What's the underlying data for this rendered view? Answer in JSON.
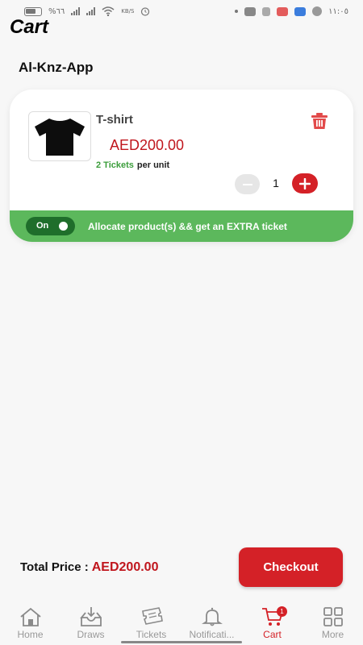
{
  "status_bar": {
    "battery": "%٦٦",
    "speed": "KB/S",
    "time": "١١:٠٥"
  },
  "page": {
    "title": "Cart",
    "app_name": "Al-Knz-App"
  },
  "cart_item": {
    "name": "T-shirt",
    "price": "AED200.00",
    "tickets": "2 Tickets",
    "per_unit": "per unit",
    "quantity": "1"
  },
  "allocate": {
    "toggle_label": "On",
    "text": "Allocate product(s) && get an EXTRA ticket"
  },
  "footer": {
    "total_label": "Total Price :",
    "total_value": "AED200.00",
    "checkout_label": "Checkout"
  },
  "nav": {
    "items": [
      {
        "label": "Home",
        "icon": "home-icon"
      },
      {
        "label": "Draws",
        "icon": "draws-icon"
      },
      {
        "label": "Tickets",
        "icon": "tickets-icon"
      },
      {
        "label": "Notificati...",
        "icon": "bell-icon"
      },
      {
        "label": "Cart",
        "icon": "cart-icon",
        "badge": "1"
      },
      {
        "label": "More",
        "icon": "grid-icon"
      }
    ]
  },
  "colors": {
    "accent": "#d42127",
    "price": "#c0161d",
    "green": "#5cb85c",
    "toggle": "#1f6e2b"
  }
}
